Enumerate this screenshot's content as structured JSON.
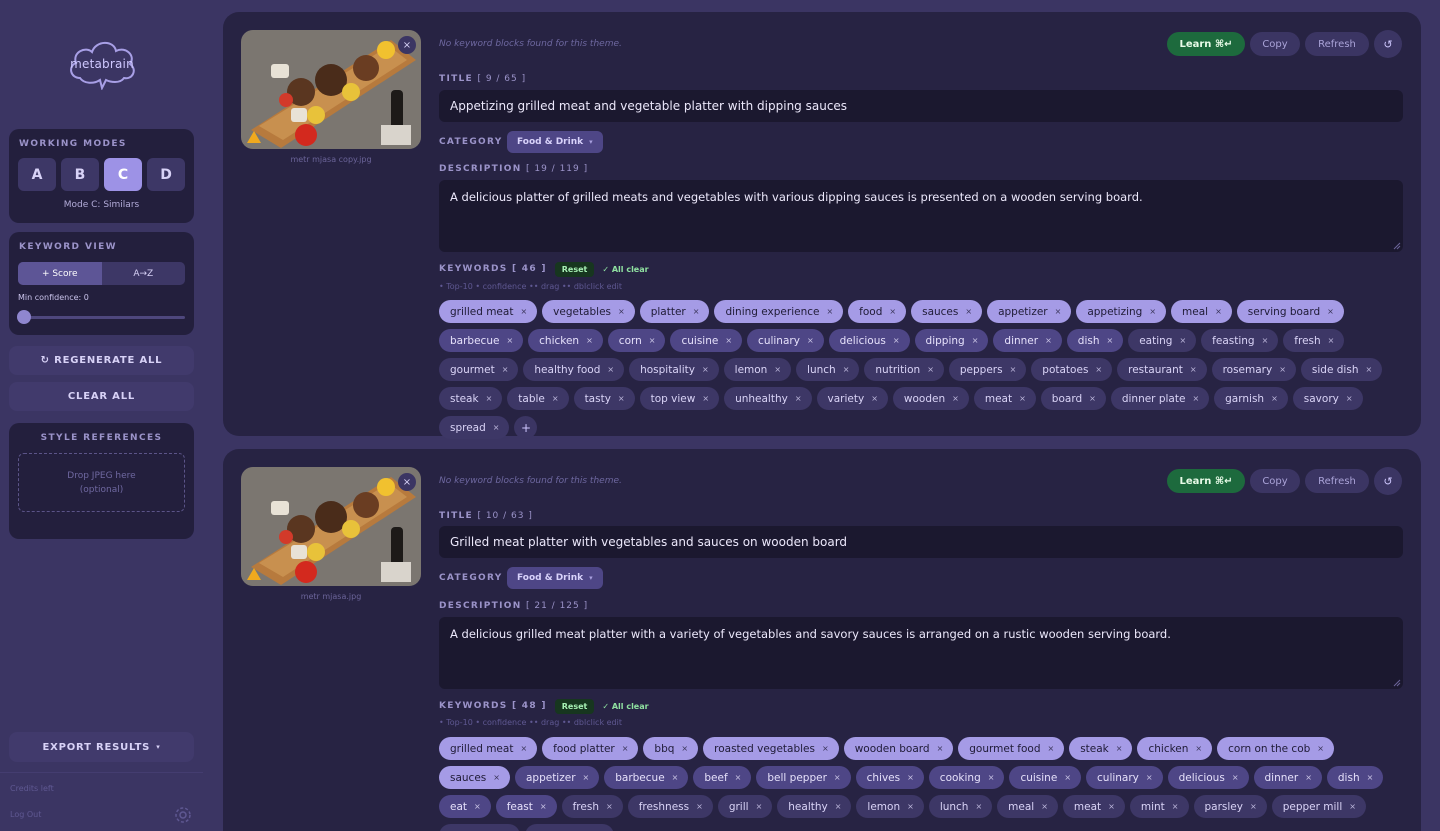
{
  "sidebar": {
    "logo_text": "metabrain",
    "working_modes": {
      "title": "WORKING MODES",
      "modes": [
        "A",
        "B",
        "C",
        "D"
      ],
      "active": "C",
      "caption": "Mode C: Similars"
    },
    "keyword_view": {
      "title": "KEYWORD VIEW",
      "options": [
        "+ Score",
        "A→Z"
      ],
      "active": "+ Score",
      "min_confidence_label": "Min confidence: 0",
      "min_confidence_value": 0
    },
    "regenerate_label": "↻ REGENERATE ALL",
    "clear_label": "CLEAR ALL",
    "style_refs": {
      "title": "STYLE REFERENCES",
      "drop_line1": "Drop JPEG here",
      "drop_line2": "(optional)"
    },
    "export_label": "EXPORT RESULTS",
    "export_caret": "▾",
    "credits_label": "Credits left",
    "logout_label": "Log Out"
  },
  "cards": [
    {
      "filename": "metr mjasa copy.jpg",
      "note": "No keyword blocks found for this theme.",
      "learn_label": "Learn ⌘↵",
      "copy_label": "Copy",
      "refresh_label": "Refresh",
      "reset_icon": "↺",
      "title_label": "TITLE",
      "title_count": "[ 9 / 65 ]",
      "title": "Appetizing grilled meat and vegetable platter with dipping sauces",
      "category_label": "CATEGORY",
      "category": "Food & Drink",
      "category_caret": "▾",
      "description_label": "DESCRIPTION",
      "description_count": "[ 19 / 119 ]",
      "description": "A delicious platter of grilled meats and vegetables with various dipping sauces is presented on a wooden serving board.",
      "keywords_label": "KEYWORDS",
      "keywords_count": "[ 46 ]",
      "reset_label": "Reset",
      "all_clear_label": "✓ All clear",
      "hint": "• Top-10 • confidence •• drag •• dblclick edit",
      "keywords_tier1": [
        "grilled meat",
        "vegetables",
        "platter",
        "dining experience",
        "food",
        "sauces",
        "appetizer",
        "appetizing",
        "meal",
        "serving board"
      ],
      "keywords_tier2": [
        "barbecue",
        "chicken",
        "corn",
        "cuisine",
        "culinary",
        "delicious",
        "dipping",
        "dinner",
        "dish"
      ],
      "keywords_tier3": [
        "eating",
        "feasting",
        "fresh",
        "gourmet",
        "healthy food",
        "hospitality",
        "lemon",
        "lunch",
        "nutrition",
        "peppers",
        "potatoes",
        "restaurant",
        "rosemary",
        "side dish",
        "steak",
        "table",
        "tasty",
        "top view",
        "unhealthy",
        "variety",
        "wooden",
        "meat",
        "board",
        "dinner plate",
        "garnish",
        "savory",
        "spread"
      ],
      "add_label": "+"
    },
    {
      "filename": "metr mjasa.jpg",
      "note": "No keyword blocks found for this theme.",
      "learn_label": "Learn ⌘↵",
      "copy_label": "Copy",
      "refresh_label": "Refresh",
      "reset_icon": "↺",
      "title_label": "TITLE",
      "title_count": "[ 10 / 63 ]",
      "title": "Grilled meat platter with vegetables and sauces on wooden board",
      "category_label": "CATEGORY",
      "category": "Food & Drink",
      "category_caret": "▾",
      "description_label": "DESCRIPTION",
      "description_count": "[ 21 / 125 ]",
      "description": "A delicious grilled meat platter with a variety of vegetables and savory sauces is arranged on a rustic wooden serving board.",
      "keywords_label": "KEYWORDS",
      "keywords_count": "[ 48 ]",
      "reset_label": "Reset",
      "all_clear_label": "✓ All clear",
      "hint": "• Top-10 • confidence •• drag •• dblclick edit",
      "keywords_tier1": [
        "grilled meat",
        "food platter",
        "bbq",
        "roasted vegetables",
        "wooden board",
        "gourmet food",
        "steak",
        "chicken",
        "corn on the cob",
        "sauces"
      ],
      "keywords_tier2": [
        "appetizer",
        "barbecue",
        "beef",
        "bell pepper",
        "chives",
        "cooking",
        "cuisine",
        "culinary",
        "delicious",
        "dinner",
        "dish",
        "eat",
        "feast"
      ],
      "keywords_tier3": [
        "fresh",
        "freshness",
        "grill",
        "healthy",
        "lemon",
        "lunch",
        "meal",
        "meat",
        "mint",
        "parsley",
        "pepper mill",
        "potatoes",
        "restaurant"
      ]
    }
  ]
}
